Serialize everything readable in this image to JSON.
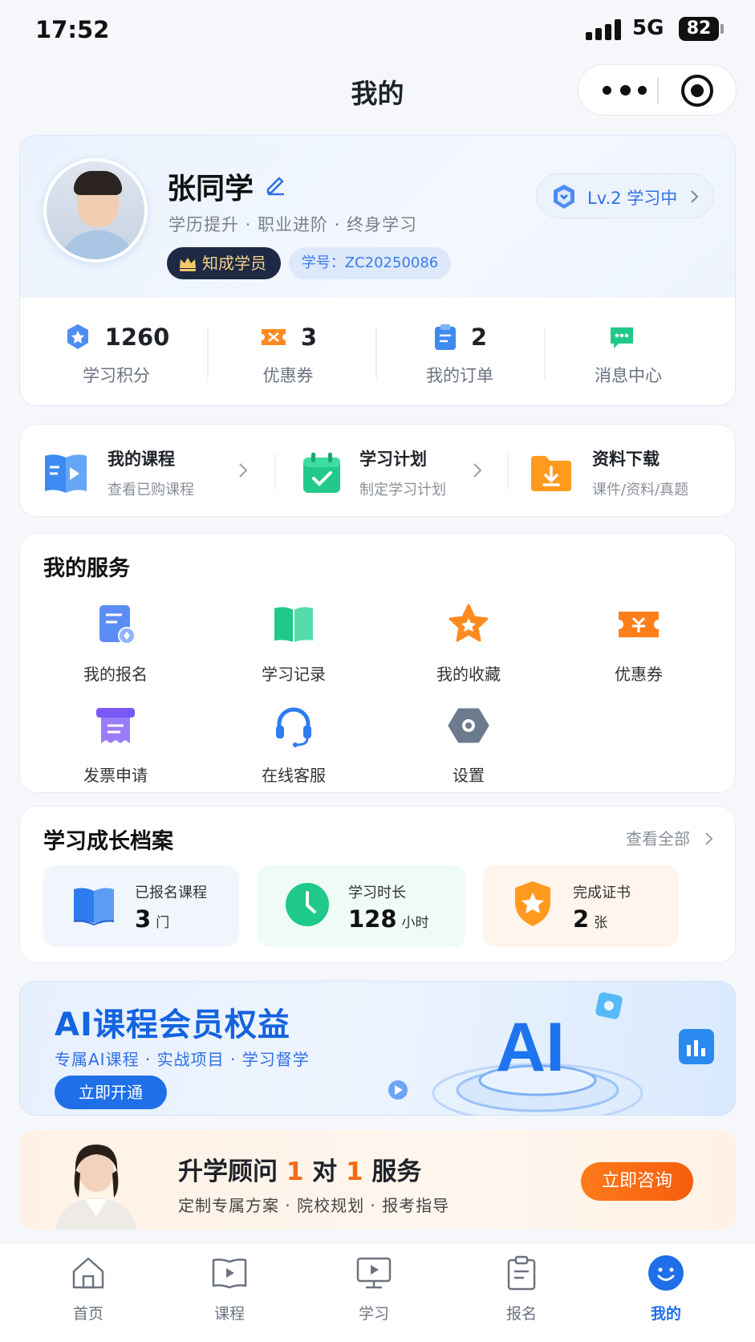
{
  "status_bar": {
    "time": "17:52",
    "network": "5G",
    "battery": "82"
  },
  "nav": {
    "title": "我的"
  },
  "profile": {
    "name": "张同学",
    "tagline": "学历提升 · 职业进阶 · 终身学习",
    "member_badge": "知成学员",
    "student_id": "学号：ZC20250086",
    "level": "Lv.2 学习中"
  },
  "stats": [
    {
      "value": "1260",
      "label": "学习积分",
      "icon": "points-icon"
    },
    {
      "value": "3",
      "label": "优惠券",
      "icon": "coupon-icon"
    },
    {
      "value": "2",
      "label": "我的订单",
      "icon": "order-icon"
    },
    {
      "value": "",
      "label": "消息中心",
      "icon": "message-icon"
    }
  ],
  "quick_links": [
    {
      "title": "我的课程",
      "subtitle": "查看已购课程",
      "icon": "course-video-icon"
    },
    {
      "title": "学习计划",
      "subtitle": "制定学习计划",
      "icon": "calendar-check-icon"
    },
    {
      "title": "资料下载",
      "subtitle": "课件/资料/真题",
      "icon": "download-folder-icon"
    }
  ],
  "services": {
    "title": "我的服务",
    "items": [
      {
        "label": "我的报名",
        "icon": "registration-icon"
      },
      {
        "label": "学习记录",
        "icon": "book-open-icon"
      },
      {
        "label": "我的收藏",
        "icon": "star-icon"
      },
      {
        "label": "优惠券",
        "icon": "coupon-icon"
      },
      {
        "label": "发票申请",
        "icon": "invoice-icon"
      },
      {
        "label": "在线客服",
        "icon": "headset-icon"
      },
      {
        "label": "设置",
        "icon": "settings-icon"
      }
    ]
  },
  "growth": {
    "title": "学习成长档案",
    "view_all": "查看全部",
    "items": [
      {
        "label": "已报名课程",
        "value": "3",
        "unit": "门",
        "icon": "book-icon"
      },
      {
        "label": "学习时长",
        "value": "128",
        "unit": "小时",
        "icon": "clock-icon"
      },
      {
        "label": "完成证书",
        "value": "2",
        "unit": "张",
        "icon": "certificate-shield-icon"
      }
    ]
  },
  "ai_banner": {
    "title": "AI课程会员权益",
    "subtitle": "专属AI课程 · 实战项目 · 学习督学",
    "button": "立即开通",
    "art_text": "AI"
  },
  "advisor_banner": {
    "title_prefix": "升学顾问 ",
    "title_hl1": "1",
    "title_mid": " 对 ",
    "title_hl2": "1",
    "title_suffix": " 服务",
    "subtitle": "定制专属方案 · 院校规划 · 报考指导",
    "button": "立即咨询"
  },
  "tabbar": [
    {
      "label": "首页",
      "icon": "home-icon",
      "active": false
    },
    {
      "label": "课程",
      "icon": "course-icon",
      "active": false
    },
    {
      "label": "学习",
      "icon": "study-monitor-icon",
      "active": false
    },
    {
      "label": "报名",
      "icon": "clipboard-icon",
      "active": false
    },
    {
      "label": "我的",
      "icon": "smile-icon",
      "active": true
    }
  ],
  "colors": {
    "primary": "#1e6fe8",
    "accent_orange": "#f46b12",
    "green": "#1fc98a"
  }
}
